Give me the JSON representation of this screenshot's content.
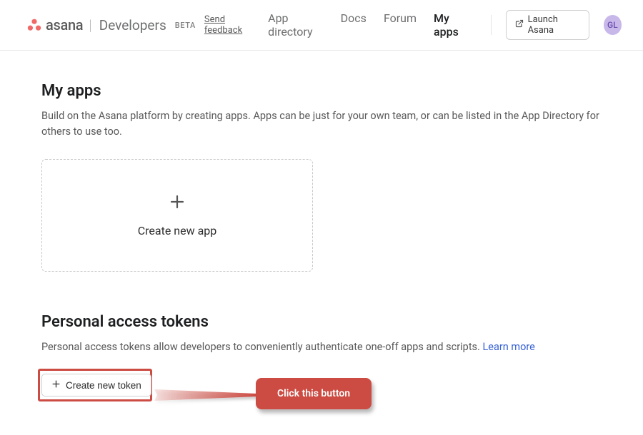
{
  "header": {
    "brand_name": "asana",
    "brand_dev": "Developers",
    "beta_badge": "BETA",
    "feedback_label": "Send feedback",
    "nav": [
      {
        "label": "App directory",
        "active": false
      },
      {
        "label": "Docs",
        "active": false
      },
      {
        "label": "Forum",
        "active": false
      },
      {
        "label": "My apps",
        "active": true
      }
    ],
    "launch_label": "Launch Asana",
    "avatar_initials": "GL"
  },
  "apps_section": {
    "title": "My apps",
    "description": "Build on the Asana platform by creating apps. Apps can be just for your own team, or can be listed in the App Directory for others to use too.",
    "create_app_label": "Create new app"
  },
  "pat_section": {
    "title": "Personal access tokens",
    "description_prefix": "Personal access tokens allow developers to conveniently authenticate one-off apps and scripts. ",
    "learn_more_label": "Learn more",
    "create_token_label": "Create new token"
  },
  "annotation": {
    "callout_text": "Click this button"
  },
  "colors": {
    "brand_red": "#f06a6a",
    "callout_red": "#cc4b42",
    "link_blue": "#3863d6",
    "avatar_bg": "#c8b8ea"
  }
}
